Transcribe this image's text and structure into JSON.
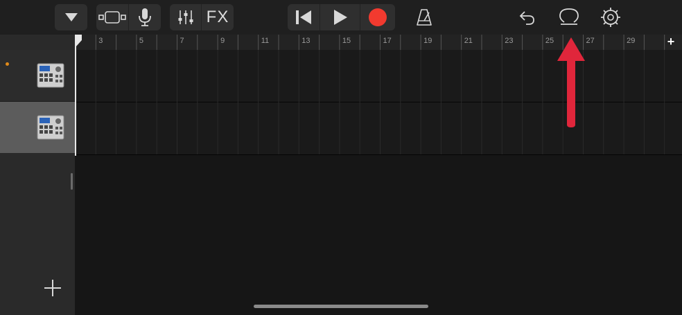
{
  "toolbar": {
    "fx_label": "FX",
    "buttons": [
      "browser-toggle",
      "track-view",
      "microphone",
      "mixer",
      "fx",
      "rewind",
      "play",
      "record",
      "metronome",
      "undo",
      "loop",
      "settings"
    ]
  },
  "colors": {
    "record": "#f23a2f",
    "annotation_arrow": "#e0263b",
    "track_dot": "#e08a1a"
  },
  "ruler": {
    "bar_numbers": [
      "3",
      "5",
      "7",
      "9",
      "11",
      "13",
      "15",
      "17",
      "19",
      "21",
      "23",
      "25",
      "27",
      "29"
    ],
    "add_label": "+"
  },
  "tracks": [
    {
      "instrument_icon": "drum-machine-icon",
      "selected": false
    },
    {
      "instrument_icon": "drum-machine-icon",
      "selected": true
    }
  ]
}
